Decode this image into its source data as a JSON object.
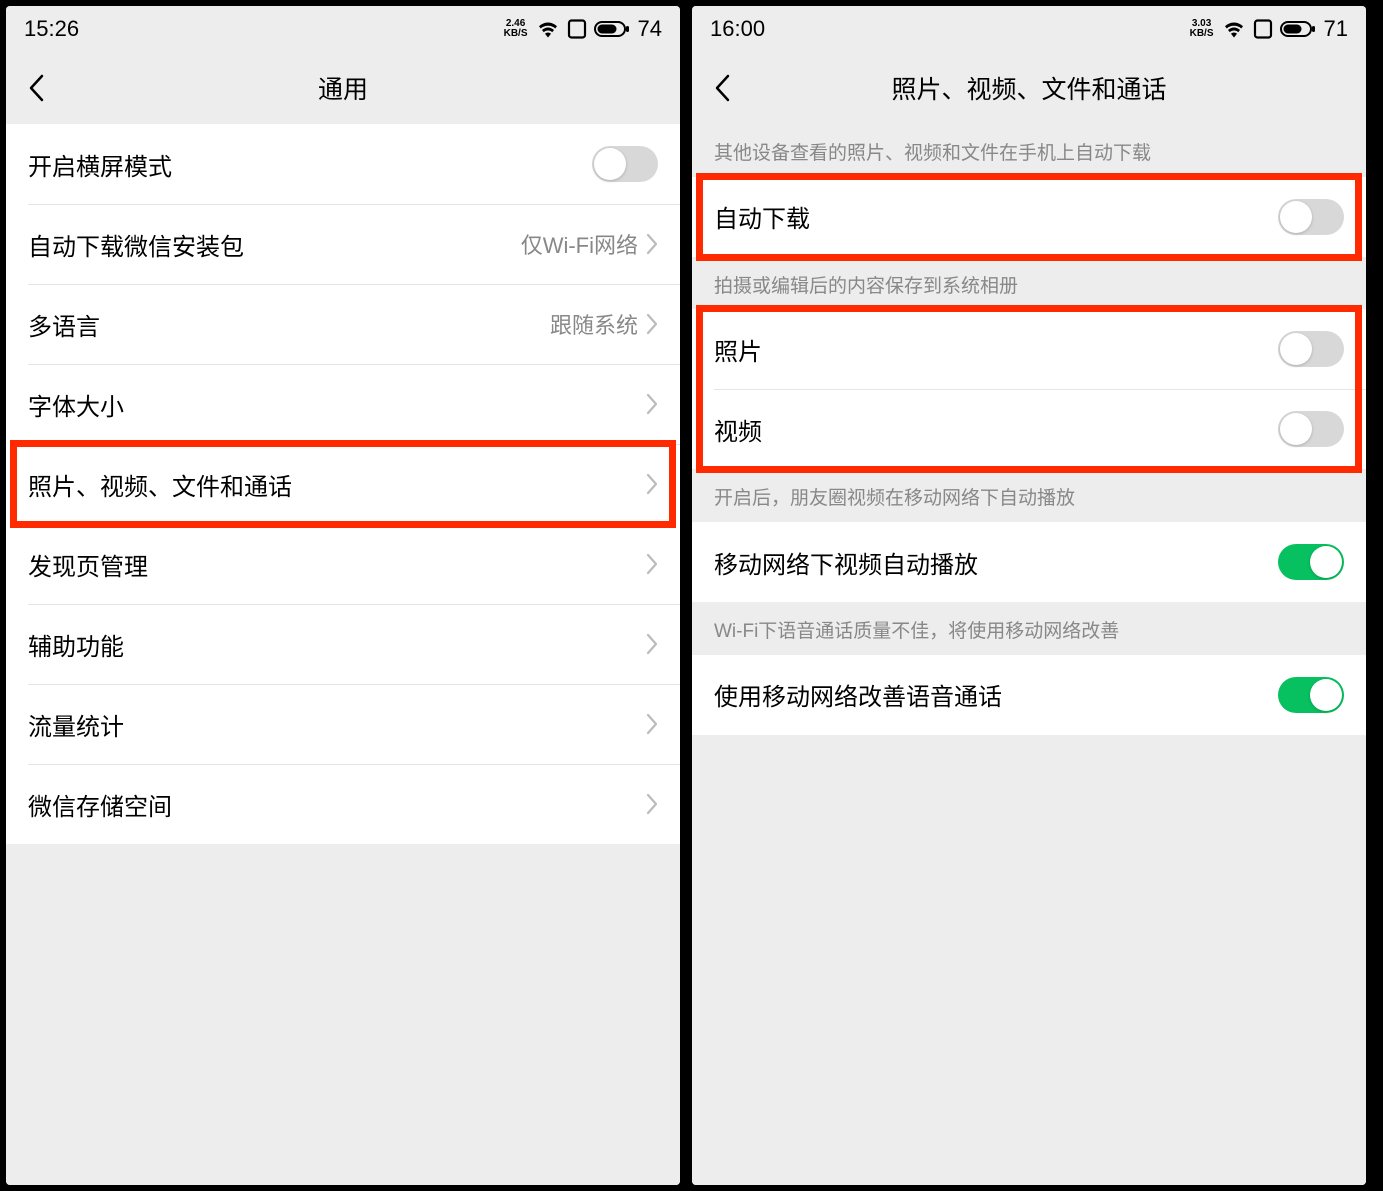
{
  "left": {
    "status": {
      "time": "15:26",
      "speed_value": "2.46",
      "speed_unit": "KB/S",
      "battery": "74"
    },
    "nav": {
      "title": "通用"
    },
    "rows": [
      {
        "label": "开启横屏模式",
        "type": "toggle",
        "on": false
      },
      {
        "label": "自动下载微信安装包",
        "type": "nav",
        "value": "仅Wi-Fi网络"
      },
      {
        "label": "多语言",
        "type": "nav",
        "value": "跟随系统"
      },
      {
        "label": "字体大小",
        "type": "nav",
        "value": ""
      },
      {
        "label": "照片、视频、文件和通话",
        "type": "nav",
        "value": "",
        "highlight": true
      },
      {
        "label": "发现页管理",
        "type": "nav",
        "value": ""
      },
      {
        "label": "辅助功能",
        "type": "nav",
        "value": ""
      },
      {
        "label": "流量统计",
        "type": "nav",
        "value": ""
      },
      {
        "label": "微信存储空间",
        "type": "nav",
        "value": ""
      }
    ]
  },
  "right": {
    "status": {
      "time": "16:00",
      "speed_value": "3.03",
      "speed_unit": "KB/S",
      "battery": "71"
    },
    "nav": {
      "title": "照片、视频、文件和通话"
    },
    "sections": [
      {
        "header": "其他设备查看的照片、视频和文件在手机上自动下载",
        "rows": [
          {
            "label": "自动下载",
            "type": "toggle",
            "on": false,
            "highlight": true
          }
        ]
      },
      {
        "header": "拍摄或编辑后的内容保存到系统相册",
        "rows": [
          {
            "label": "照片",
            "type": "toggle",
            "on": false,
            "highlight": "group"
          },
          {
            "label": "视频",
            "type": "toggle",
            "on": false,
            "highlight": "group"
          }
        ]
      },
      {
        "header": "开启后，朋友圈视频在移动网络下自动播放",
        "rows": [
          {
            "label": "移动网络下视频自动播放",
            "type": "toggle",
            "on": true
          }
        ]
      },
      {
        "header": "Wi-Fi下语音通话质量不佳，将使用移动网络改善",
        "rows": [
          {
            "label": "使用移动网络改善语音通话",
            "type": "toggle",
            "on": true
          }
        ]
      }
    ]
  }
}
